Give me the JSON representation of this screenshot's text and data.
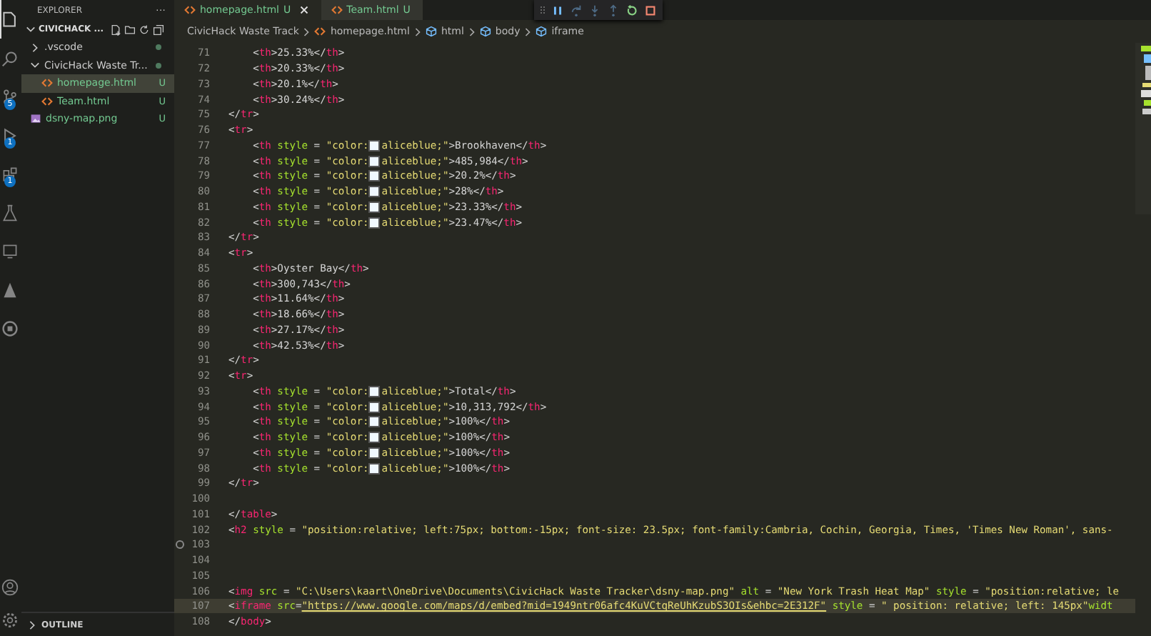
{
  "activity_bar": [
    {
      "kind": "explorer",
      "selected": true
    },
    {
      "kind": "search",
      "selected": false
    },
    {
      "kind": "source-control",
      "selected": false,
      "badge": "5"
    },
    {
      "kind": "debug",
      "selected": false,
      "badge": "1"
    },
    {
      "kind": "extensions",
      "selected": false,
      "badge": "1"
    },
    {
      "kind": "flask",
      "selected": false
    },
    {
      "kind": "remote",
      "selected": false
    },
    {
      "kind": "letter",
      "selected": false
    },
    {
      "kind": "chat",
      "selected": false
    }
  ],
  "activity_bottom": [
    {
      "kind": "account"
    },
    {
      "kind": "gear"
    }
  ],
  "sidebar": {
    "title": "EXPLORER",
    "more": "···",
    "root": "CIVICHACK ...",
    "items": [
      {
        "kind": "folder",
        "name": ".vscode",
        "expanded": false,
        "selected": false,
        "changes_dot": true
      },
      {
        "kind": "folder",
        "name": "CivicHack Waste Tr...",
        "expanded": true,
        "selected": false,
        "changes_dot": true,
        "children": [
          {
            "kind": "html",
            "name": "homepage.html",
            "status": "U",
            "selected": true
          },
          {
            "kind": "html",
            "name": "Team.html",
            "status": "U",
            "selected": false
          }
        ]
      },
      {
        "kind": "image",
        "name": "dsny-map.png",
        "status": "U",
        "selected": false
      }
    ],
    "outline": "OUTLINE"
  },
  "tabs": [
    {
      "label": "homepage.html",
      "status": "U",
      "selected": true,
      "closable": true
    },
    {
      "label": "Team.html",
      "status": "U",
      "selected": false,
      "closable": false
    }
  ],
  "debug_toolbar": [
    {
      "kind": "pause"
    },
    {
      "kind": "step-over"
    },
    {
      "kind": "step-into"
    },
    {
      "kind": "step-out"
    },
    {
      "kind": "restart"
    },
    {
      "kind": "stop"
    }
  ],
  "breadcrumb": [
    {
      "kind": "folder",
      "label": "CivicHack Waste Track"
    },
    {
      "kind": "html",
      "label": "homepage.html"
    },
    {
      "kind": "element",
      "label": "html"
    },
    {
      "kind": "element",
      "label": "body"
    },
    {
      "kind": "element",
      "label": "iframe"
    }
  ],
  "lines": [
    {
      "number": "71",
      "current": false,
      "gutter_mark": false,
      "tokens": [
        {
          "kind": "punct",
          "text": "    <"
        },
        {
          "kind": "tag",
          "text": "th"
        },
        {
          "kind": "punct",
          "text": ">25.33%</"
        },
        {
          "kind": "tag",
          "text": "th"
        },
        {
          "kind": "punct",
          "text": ">"
        }
      ]
    },
    {
      "number": "72",
      "current": false,
      "gutter_mark": false,
      "tokens": [
        {
          "kind": "punct",
          "text": "    <"
        },
        {
          "kind": "tag",
          "text": "th"
        },
        {
          "kind": "punct",
          "text": ">20.33%</"
        },
        {
          "kind": "tag",
          "text": "th"
        },
        {
          "kind": "punct",
          "text": ">"
        }
      ]
    },
    {
      "number": "73",
      "current": false,
      "gutter_mark": false,
      "tokens": [
        {
          "kind": "punct",
          "text": "    <"
        },
        {
          "kind": "tag",
          "text": "th"
        },
        {
          "kind": "punct",
          "text": ">20.1%</"
        },
        {
          "kind": "tag",
          "text": "th"
        },
        {
          "kind": "punct",
          "text": ">"
        }
      ]
    },
    {
      "number": "74",
      "current": false,
      "gutter_mark": false,
      "tokens": [
        {
          "kind": "punct",
          "text": "    <"
        },
        {
          "kind": "tag",
          "text": "th"
        },
        {
          "kind": "punct",
          "text": ">30.24%</"
        },
        {
          "kind": "tag",
          "text": "th"
        },
        {
          "kind": "punct",
          "text": ">"
        }
      ]
    },
    {
      "number": "75",
      "current": false,
      "gutter_mark": false,
      "tokens": [
        {
          "kind": "punct",
          "text": "</"
        },
        {
          "kind": "tag",
          "text": "tr"
        },
        {
          "kind": "punct",
          "text": ">"
        }
      ]
    },
    {
      "number": "76",
      "current": false,
      "gutter_mark": false,
      "tokens": [
        {
          "kind": "punct",
          "text": "<"
        },
        {
          "kind": "tag",
          "text": "tr"
        },
        {
          "kind": "punct",
          "text": ">"
        }
      ]
    },
    {
      "number": "77",
      "current": false,
      "gutter_mark": false,
      "tokens": [
        {
          "kind": "punct",
          "text": "    <"
        },
        {
          "kind": "tag",
          "text": "th"
        },
        {
          "kind": "attr",
          "text": " style"
        },
        {
          "kind": "punct",
          "text": " = "
        },
        {
          "kind": "string",
          "text": "\"color:"
        },
        {
          "kind": "swatch"
        },
        {
          "kind": "string",
          "text": "aliceblue;\""
        },
        {
          "kind": "punct",
          "text": ">Brookhaven</"
        },
        {
          "kind": "tag",
          "text": "th"
        },
        {
          "kind": "punct",
          "text": ">"
        }
      ]
    },
    {
      "number": "78",
      "current": false,
      "gutter_mark": false,
      "tokens": [
        {
          "kind": "punct",
          "text": "    <"
        },
        {
          "kind": "tag",
          "text": "th"
        },
        {
          "kind": "attr",
          "text": " style"
        },
        {
          "kind": "punct",
          "text": " = "
        },
        {
          "kind": "string",
          "text": "\"color:"
        },
        {
          "kind": "swatch"
        },
        {
          "kind": "string",
          "text": "aliceblue;\""
        },
        {
          "kind": "punct",
          "text": ">485,984</"
        },
        {
          "kind": "tag",
          "text": "th"
        },
        {
          "kind": "punct",
          "text": ">"
        }
      ]
    },
    {
      "number": "79",
      "current": false,
      "gutter_mark": false,
      "tokens": [
        {
          "kind": "punct",
          "text": "    <"
        },
        {
          "kind": "tag",
          "text": "th"
        },
        {
          "kind": "attr",
          "text": " style"
        },
        {
          "kind": "punct",
          "text": " = "
        },
        {
          "kind": "string",
          "text": "\"color:"
        },
        {
          "kind": "swatch"
        },
        {
          "kind": "string",
          "text": "aliceblue;\""
        },
        {
          "kind": "punct",
          "text": ">20.2%</"
        },
        {
          "kind": "tag",
          "text": "th"
        },
        {
          "kind": "punct",
          "text": ">"
        }
      ]
    },
    {
      "number": "80",
      "current": false,
      "gutter_mark": false,
      "tokens": [
        {
          "kind": "punct",
          "text": "    <"
        },
        {
          "kind": "tag",
          "text": "th"
        },
        {
          "kind": "attr",
          "text": " style"
        },
        {
          "kind": "punct",
          "text": " = "
        },
        {
          "kind": "string",
          "text": "\"color:"
        },
        {
          "kind": "swatch"
        },
        {
          "kind": "string",
          "text": "aliceblue;\""
        },
        {
          "kind": "punct",
          "text": ">28%</"
        },
        {
          "kind": "tag",
          "text": "th"
        },
        {
          "kind": "punct",
          "text": ">"
        }
      ]
    },
    {
      "number": "81",
      "current": false,
      "gutter_mark": false,
      "tokens": [
        {
          "kind": "punct",
          "text": "    <"
        },
        {
          "kind": "tag",
          "text": "th"
        },
        {
          "kind": "attr",
          "text": " style"
        },
        {
          "kind": "punct",
          "text": " = "
        },
        {
          "kind": "string",
          "text": "\"color:"
        },
        {
          "kind": "swatch"
        },
        {
          "kind": "string",
          "text": "aliceblue;\""
        },
        {
          "kind": "punct",
          "text": ">23.33%</"
        },
        {
          "kind": "tag",
          "text": "th"
        },
        {
          "kind": "punct",
          "text": ">"
        }
      ]
    },
    {
      "number": "82",
      "current": false,
      "gutter_mark": false,
      "tokens": [
        {
          "kind": "punct",
          "text": "    <"
        },
        {
          "kind": "tag",
          "text": "th"
        },
        {
          "kind": "attr",
          "text": " style"
        },
        {
          "kind": "punct",
          "text": " = "
        },
        {
          "kind": "string",
          "text": "\"color:"
        },
        {
          "kind": "swatch"
        },
        {
          "kind": "string",
          "text": "aliceblue;\""
        },
        {
          "kind": "punct",
          "text": ">23.47%</"
        },
        {
          "kind": "tag",
          "text": "th"
        },
        {
          "kind": "punct",
          "text": ">"
        }
      ]
    },
    {
      "number": "83",
      "current": false,
      "gutter_mark": false,
      "tokens": [
        {
          "kind": "punct",
          "text": "</"
        },
        {
          "kind": "tag",
          "text": "tr"
        },
        {
          "kind": "punct",
          "text": ">"
        }
      ]
    },
    {
      "number": "84",
      "current": false,
      "gutter_mark": false,
      "tokens": [
        {
          "kind": "punct",
          "text": "<"
        },
        {
          "kind": "tag",
          "text": "tr"
        },
        {
          "kind": "punct",
          "text": ">"
        }
      ]
    },
    {
      "number": "85",
      "current": false,
      "gutter_mark": false,
      "tokens": [
        {
          "kind": "punct",
          "text": "    <"
        },
        {
          "kind": "tag",
          "text": "th"
        },
        {
          "kind": "punct",
          "text": ">Oyster Bay</"
        },
        {
          "kind": "tag",
          "text": "th"
        },
        {
          "kind": "punct",
          "text": ">"
        }
      ]
    },
    {
      "number": "86",
      "current": false,
      "gutter_mark": false,
      "tokens": [
        {
          "kind": "punct",
          "text": "    <"
        },
        {
          "kind": "tag",
          "text": "th"
        },
        {
          "kind": "punct",
          "text": ">300,743</"
        },
        {
          "kind": "tag",
          "text": "th"
        },
        {
          "kind": "punct",
          "text": ">"
        }
      ]
    },
    {
      "number": "87",
      "current": false,
      "gutter_mark": false,
      "tokens": [
        {
          "kind": "punct",
          "text": "    <"
        },
        {
          "kind": "tag",
          "text": "th"
        },
        {
          "kind": "punct",
          "text": ">11.64%</"
        },
        {
          "kind": "tag",
          "text": "th"
        },
        {
          "kind": "punct",
          "text": ">"
        }
      ]
    },
    {
      "number": "88",
      "current": false,
      "gutter_mark": false,
      "tokens": [
        {
          "kind": "punct",
          "text": "    <"
        },
        {
          "kind": "tag",
          "text": "th"
        },
        {
          "kind": "punct",
          "text": ">18.66%</"
        },
        {
          "kind": "tag",
          "text": "th"
        },
        {
          "kind": "punct",
          "text": ">"
        }
      ]
    },
    {
      "number": "89",
      "current": false,
      "gutter_mark": false,
      "tokens": [
        {
          "kind": "punct",
          "text": "    <"
        },
        {
          "kind": "tag",
          "text": "th"
        },
        {
          "kind": "punct",
          "text": ">27.17%</"
        },
        {
          "kind": "tag",
          "text": "th"
        },
        {
          "kind": "punct",
          "text": ">"
        }
      ]
    },
    {
      "number": "90",
      "current": false,
      "gutter_mark": false,
      "tokens": [
        {
          "kind": "punct",
          "text": "    <"
        },
        {
          "kind": "tag",
          "text": "th"
        },
        {
          "kind": "punct",
          "text": ">42.53%</"
        },
        {
          "kind": "tag",
          "text": "th"
        },
        {
          "kind": "punct",
          "text": ">"
        }
      ]
    },
    {
      "number": "91",
      "current": false,
      "gutter_mark": false,
      "tokens": [
        {
          "kind": "punct",
          "text": "</"
        },
        {
          "kind": "tag",
          "text": "tr"
        },
        {
          "kind": "punct",
          "text": ">"
        }
      ]
    },
    {
      "number": "92",
      "current": false,
      "gutter_mark": false,
      "tokens": [
        {
          "kind": "punct",
          "text": "<"
        },
        {
          "kind": "tag",
          "text": "tr"
        },
        {
          "kind": "punct",
          "text": ">"
        }
      ]
    },
    {
      "number": "93",
      "current": false,
      "gutter_mark": false,
      "tokens": [
        {
          "kind": "punct",
          "text": "    <"
        },
        {
          "kind": "tag",
          "text": "th"
        },
        {
          "kind": "attr",
          "text": " style"
        },
        {
          "kind": "punct",
          "text": " = "
        },
        {
          "kind": "string",
          "text": "\"color:"
        },
        {
          "kind": "swatch"
        },
        {
          "kind": "string",
          "text": "aliceblue;\""
        },
        {
          "kind": "punct",
          "text": ">Total</"
        },
        {
          "kind": "tag",
          "text": "th"
        },
        {
          "kind": "punct",
          "text": ">"
        }
      ]
    },
    {
      "number": "94",
      "current": false,
      "gutter_mark": false,
      "tokens": [
        {
          "kind": "punct",
          "text": "    <"
        },
        {
          "kind": "tag",
          "text": "th"
        },
        {
          "kind": "attr",
          "text": " style"
        },
        {
          "kind": "punct",
          "text": " = "
        },
        {
          "kind": "string",
          "text": "\"color:"
        },
        {
          "kind": "swatch"
        },
        {
          "kind": "string",
          "text": "aliceblue;\""
        },
        {
          "kind": "punct",
          "text": ">10,313,792</"
        },
        {
          "kind": "tag",
          "text": "th"
        },
        {
          "kind": "punct",
          "text": ">"
        }
      ]
    },
    {
      "number": "95",
      "current": false,
      "gutter_mark": false,
      "tokens": [
        {
          "kind": "punct",
          "text": "    <"
        },
        {
          "kind": "tag",
          "text": "th"
        },
        {
          "kind": "attr",
          "text": " style"
        },
        {
          "kind": "punct",
          "text": " = "
        },
        {
          "kind": "string",
          "text": "\"color:"
        },
        {
          "kind": "swatch"
        },
        {
          "kind": "string",
          "text": "aliceblue;\""
        },
        {
          "kind": "punct",
          "text": ">100%</"
        },
        {
          "kind": "tag",
          "text": "th"
        },
        {
          "kind": "punct",
          "text": ">"
        }
      ]
    },
    {
      "number": "96",
      "current": false,
      "gutter_mark": false,
      "tokens": [
        {
          "kind": "punct",
          "text": "    <"
        },
        {
          "kind": "tag",
          "text": "th"
        },
        {
          "kind": "attr",
          "text": " style"
        },
        {
          "kind": "punct",
          "text": " = "
        },
        {
          "kind": "string",
          "text": "\"color:"
        },
        {
          "kind": "swatch"
        },
        {
          "kind": "string",
          "text": "aliceblue;\""
        },
        {
          "kind": "punct",
          "text": ">100%</"
        },
        {
          "kind": "tag",
          "text": "th"
        },
        {
          "kind": "punct",
          "text": ">"
        }
      ]
    },
    {
      "number": "97",
      "current": false,
      "gutter_mark": false,
      "tokens": [
        {
          "kind": "punct",
          "text": "    <"
        },
        {
          "kind": "tag",
          "text": "th"
        },
        {
          "kind": "attr",
          "text": " style"
        },
        {
          "kind": "punct",
          "text": " = "
        },
        {
          "kind": "string",
          "text": "\"color:"
        },
        {
          "kind": "swatch"
        },
        {
          "kind": "string",
          "text": "aliceblue;\""
        },
        {
          "kind": "punct",
          "text": ">100%</"
        },
        {
          "kind": "tag",
          "text": "th"
        },
        {
          "kind": "punct",
          "text": ">"
        }
      ]
    },
    {
      "number": "98",
      "current": false,
      "gutter_mark": false,
      "tokens": [
        {
          "kind": "punct",
          "text": "    <"
        },
        {
          "kind": "tag",
          "text": "th"
        },
        {
          "kind": "attr",
          "text": " style"
        },
        {
          "kind": "punct",
          "text": " = "
        },
        {
          "kind": "string",
          "text": "\"color:"
        },
        {
          "kind": "swatch"
        },
        {
          "kind": "string",
          "text": "aliceblue;\""
        },
        {
          "kind": "punct",
          "text": ">100%</"
        },
        {
          "kind": "tag",
          "text": "th"
        },
        {
          "kind": "punct",
          "text": ">"
        }
      ]
    },
    {
      "number": "99",
      "current": false,
      "gutter_mark": false,
      "tokens": [
        {
          "kind": "punct",
          "text": "</"
        },
        {
          "kind": "tag",
          "text": "tr"
        },
        {
          "kind": "punct",
          "text": ">"
        }
      ]
    },
    {
      "number": "100",
      "current": false,
      "gutter_mark": false
    },
    {
      "number": "101",
      "current": false,
      "gutter_mark": false,
      "tokens": [
        {
          "kind": "punct",
          "text": "</"
        },
        {
          "kind": "tag",
          "text": "table"
        },
        {
          "kind": "punct",
          "text": ">"
        }
      ]
    },
    {
      "number": "102",
      "current": false,
      "gutter_mark": false,
      "tokens": [
        {
          "kind": "punct",
          "text": "<"
        },
        {
          "kind": "tag",
          "text": "h2"
        },
        {
          "kind": "attr",
          "text": " style"
        },
        {
          "kind": "punct",
          "text": " = "
        },
        {
          "kind": "string",
          "text": "\"position:relative; left:75px; bottom:-15px; font-size: 23.5px; font-family:Cambria, Cochin, Georgia, Times, 'Times New Roman', sans-"
        }
      ]
    },
    {
      "number": "103",
      "current": false,
      "gutter_mark": true
    },
    {
      "number": "104",
      "current": false,
      "gutter_mark": false
    },
    {
      "number": "105",
      "current": false,
      "gutter_mark": false
    },
    {
      "number": "106",
      "current": false,
      "gutter_mark": false,
      "tokens": [
        {
          "kind": "punct",
          "text": "<"
        },
        {
          "kind": "tag",
          "text": "img"
        },
        {
          "kind": "attr",
          "text": " src"
        },
        {
          "kind": "punct",
          "text": " = "
        },
        {
          "kind": "string",
          "text": "\"C:\\Users\\kaart\\OneDrive\\Documents\\CivicHack Waste Tracker\\dsny-map.png\""
        },
        {
          "kind": "attr",
          "text": " alt"
        },
        {
          "kind": "punct",
          "text": " = "
        },
        {
          "kind": "string",
          "text": "\"New York Trash Heat Map\""
        },
        {
          "kind": "attr",
          "text": " style"
        },
        {
          "kind": "punct",
          "text": " = "
        },
        {
          "kind": "string",
          "text": "\"position:relative; le"
        }
      ]
    },
    {
      "number": "107",
      "current": true,
      "gutter_mark": false,
      "tokens": [
        {
          "kind": "punct",
          "text": "<"
        },
        {
          "kind": "tag",
          "text": "iframe"
        },
        {
          "kind": "attr",
          "text": " src"
        },
        {
          "kind": "punct",
          "text": "="
        },
        {
          "kind": "link",
          "text": "\"https://www.google.com/maps/d/embed?mid=1949ntr06afc4KuVCtqReUhKzubS3OIs&ehbc=2E312F\""
        },
        {
          "kind": "attr",
          "text": " style"
        },
        {
          "kind": "punct",
          "text": " = "
        },
        {
          "kind": "string",
          "text": "\" position: relative; left: 145px\""
        },
        {
          "kind": "attr",
          "text": "widt"
        }
      ]
    },
    {
      "number": "108",
      "current": false,
      "gutter_mark": false,
      "tokens": [
        {
          "kind": "punct",
          "text": "</"
        },
        {
          "kind": "tag",
          "text": "body"
        },
        {
          "kind": "punct",
          "text": ">"
        }
      ]
    }
  ]
}
